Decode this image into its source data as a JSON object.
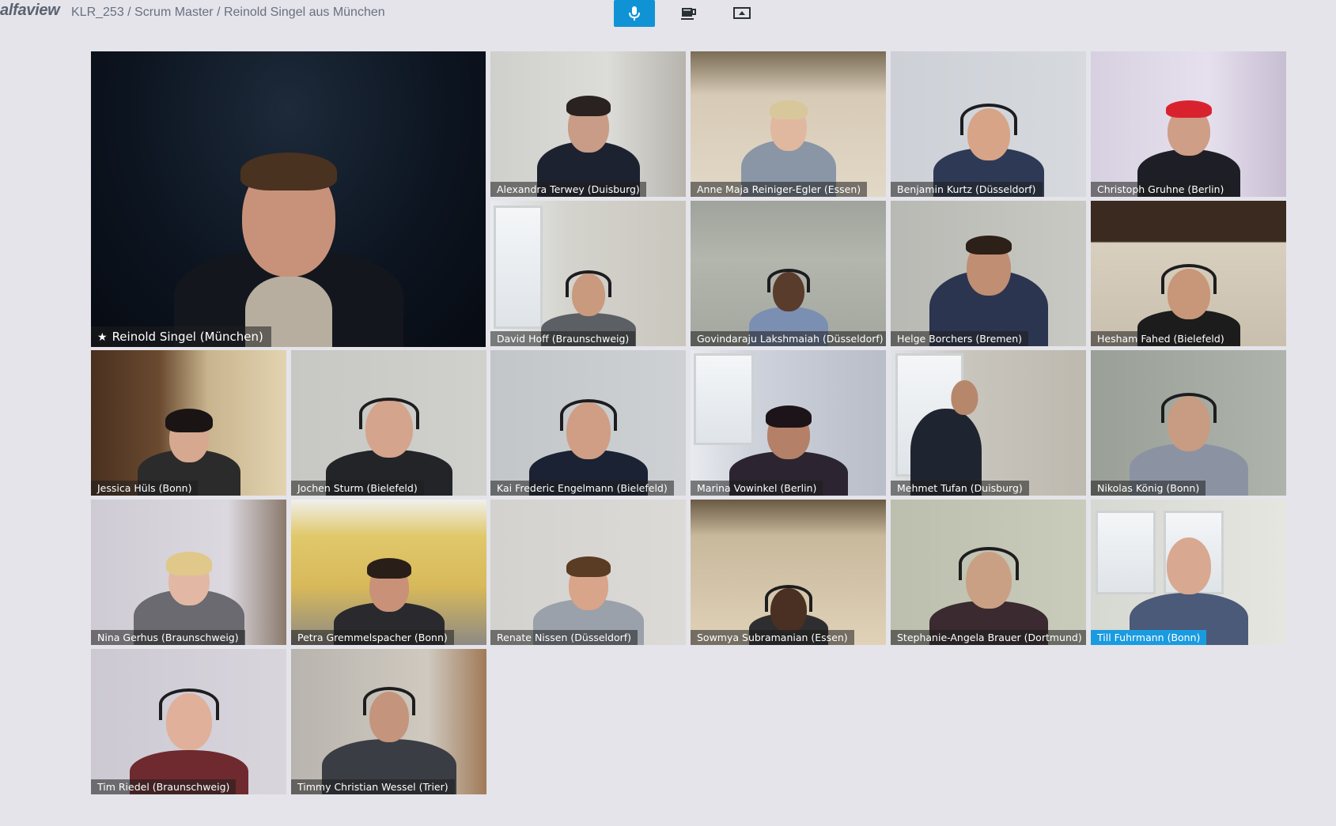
{
  "app": {
    "logo": "alfaview",
    "breadcrumb": "KLR_253 / Scrum Master / Reinold Singel aus München"
  },
  "toolbar": {
    "buttons": [
      {
        "icon": "microphone-icon",
        "active": true
      },
      {
        "icon": "coffee-cup-icon",
        "active": false
      },
      {
        "icon": "screen-share-icon",
        "active": false
      }
    ]
  },
  "colors": {
    "accent": "#1a9be0",
    "background": "#e4e4ea"
  },
  "participants": [
    {
      "name": "Reinold Singel (München)",
      "presenter": true
    },
    {
      "name": "Alexandra Terwey (Duisburg)"
    },
    {
      "name": "Anne Maja Reiniger-Egler (Essen)"
    },
    {
      "name": "Benjamin Kurtz (Düsseldorf)"
    },
    {
      "name": "Christoph Gruhne (Berlin)"
    },
    {
      "name": "David Hoff (Braunschweig)"
    },
    {
      "name": "Govindaraju Lakshmaiah (Düsseldorf)"
    },
    {
      "name": "Helge Borchers (Bremen)"
    },
    {
      "name": "Hesham Fahed (Bielefeld)"
    },
    {
      "name": "Jessica Hüls (Bonn)"
    },
    {
      "name": "Jochen Sturm (Bielefeld)"
    },
    {
      "name": "Kai Frederic Engelmann (Bielefeld)"
    },
    {
      "name": "Marina Vowinkel (Berlin)"
    },
    {
      "name": "Mehmet Tufan (Duisburg)"
    },
    {
      "name": "Nikolas König (Bonn)"
    },
    {
      "name": "Nina Gerhus (Braunschweig)"
    },
    {
      "name": "Petra Gremmelspacher (Bonn)"
    },
    {
      "name": "Renate Nissen (Düsseldorf)"
    },
    {
      "name": "Sowmya Subramanian (Essen)"
    },
    {
      "name": "Stephanie-Angela Brauer (Dortmund)"
    },
    {
      "name": "Till Fuhrmann (Bonn)",
      "speaking": true
    },
    {
      "name": "Tim Riedel (Braunschweig)"
    },
    {
      "name": "Timmy Christian Wessel (Trier)"
    }
  ]
}
